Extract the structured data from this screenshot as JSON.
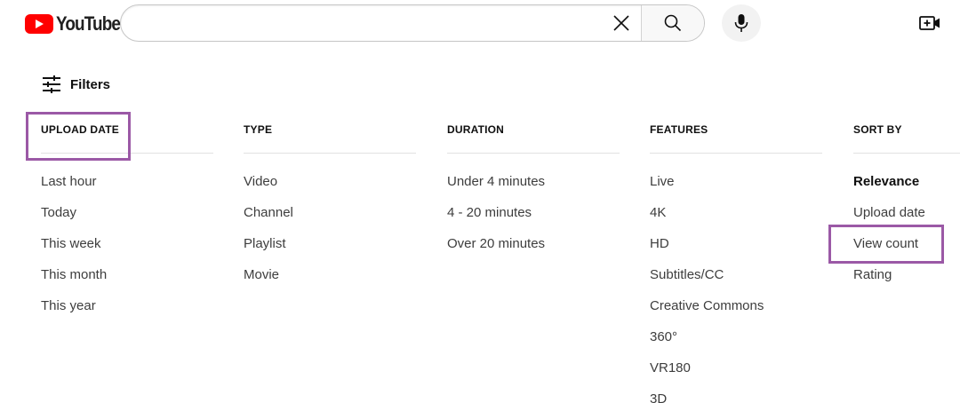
{
  "header": {
    "logo_text": "YouTube",
    "search": {
      "value": "",
      "placeholder": ""
    },
    "icons": {
      "clear": "close-icon",
      "search": "search-icon",
      "mic": "microphone-icon",
      "create": "video-camera-plus-icon"
    }
  },
  "filters": {
    "label": "Filters",
    "icon": "filters-sliders-icon"
  },
  "columns": [
    {
      "key": "upload_date",
      "header": "UPLOAD DATE",
      "items": [
        "Last hour",
        "Today",
        "This week",
        "This month",
        "This year"
      ]
    },
    {
      "key": "type",
      "header": "TYPE",
      "items": [
        "Video",
        "Channel",
        "Playlist",
        "Movie"
      ]
    },
    {
      "key": "duration",
      "header": "DURATION",
      "items": [
        "Under 4 minutes",
        "4 - 20 minutes",
        "Over 20 minutes"
      ]
    },
    {
      "key": "features",
      "header": "FEATURES",
      "items": [
        "Live",
        "4K",
        "HD",
        "Subtitles/CC",
        "Creative Commons",
        "360°",
        "VR180",
        "3D"
      ]
    },
    {
      "key": "sort_by",
      "header": "SORT BY",
      "items": [
        "Relevance",
        "Upload date",
        "View count",
        "Rating"
      ],
      "selected": "Relevance"
    }
  ],
  "colors": {
    "brand_red": "#ff0000",
    "highlight": "#9b59a6",
    "text_primary": "#0f0f0f",
    "text_secondary": "#3d3d3d"
  }
}
